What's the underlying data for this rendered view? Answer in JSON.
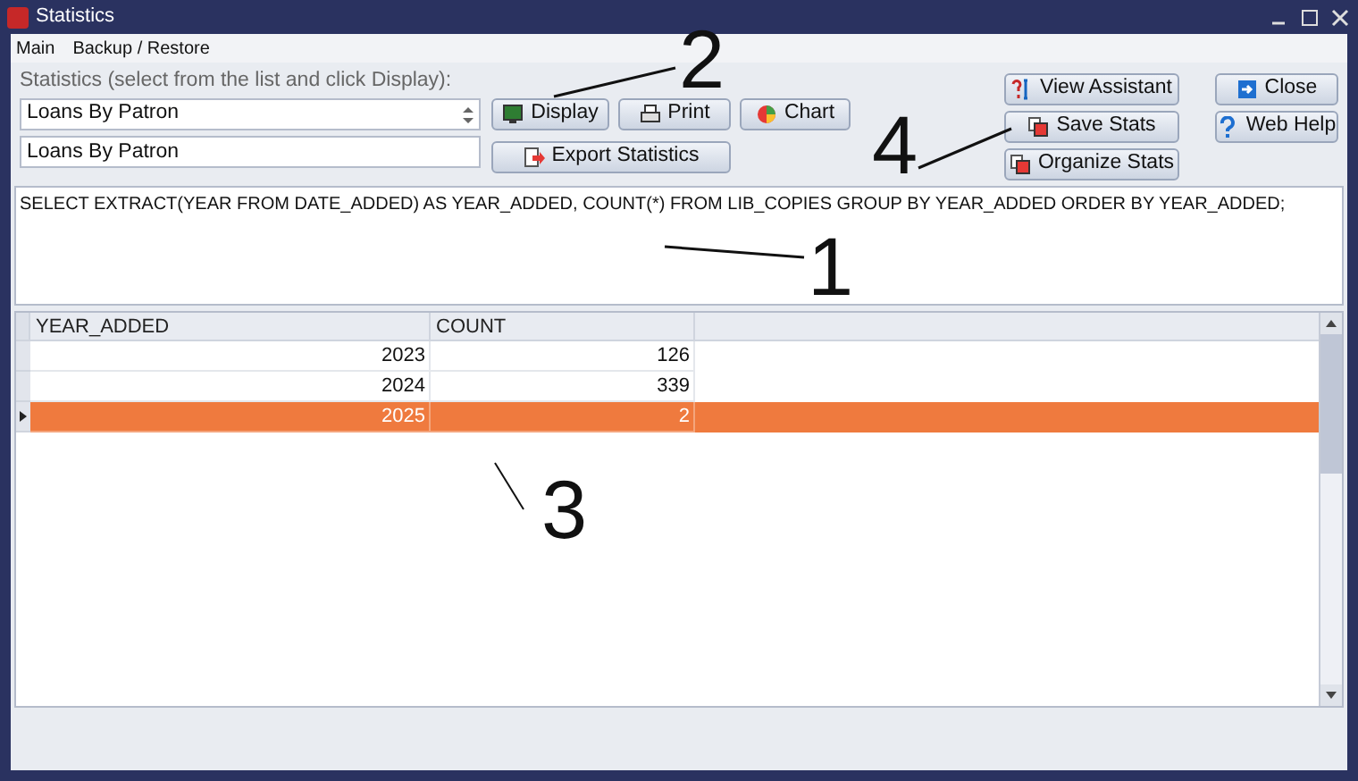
{
  "window": {
    "title": "Statistics"
  },
  "menu": [
    "Main",
    "Backup / Restore"
  ],
  "statistics": {
    "label": "Statistics (select from the list and click Display):",
    "selected": "Loans By Patron",
    "name_value": "Loans By Patron"
  },
  "action_buttons": [
    {
      "label": "Display",
      "kind": "monitor"
    },
    {
      "label": "Print",
      "kind": "printer"
    },
    {
      "label": "Chart",
      "kind": "chart"
    },
    {
      "label": "Export Statistics",
      "kind": "export"
    }
  ],
  "stats_buttons": [
    {
      "label": "View Assistant",
      "kind": "assistant"
    },
    {
      "label": "Save Stats",
      "kind": "save"
    },
    {
      "label": "Organize Stats",
      "kind": "save"
    }
  ],
  "window_buttons": [
    {
      "label": "Close",
      "kind": "close"
    },
    {
      "label": "Web Help",
      "kind": "help"
    }
  ],
  "sql": "SELECT EXTRACT(YEAR FROM DATE_ADDED) AS YEAR_ADDED, COUNT(*) FROM LIB_COPIES GROUP BY YEAR_ADDED ORDER BY YEAR_ADDED;",
  "table": {
    "columns": [
      "YEAR_ADDED",
      "COUNT"
    ],
    "rows": [
      {
        "cells": [
          "2023",
          "126"
        ],
        "selected": false
      },
      {
        "cells": [
          "2024",
          "339"
        ],
        "selected": false
      },
      {
        "cells": [
          "2025",
          "2"
        ],
        "selected": true
      }
    ]
  },
  "annotations": [
    "1",
    "2",
    "3",
    "4"
  ]
}
